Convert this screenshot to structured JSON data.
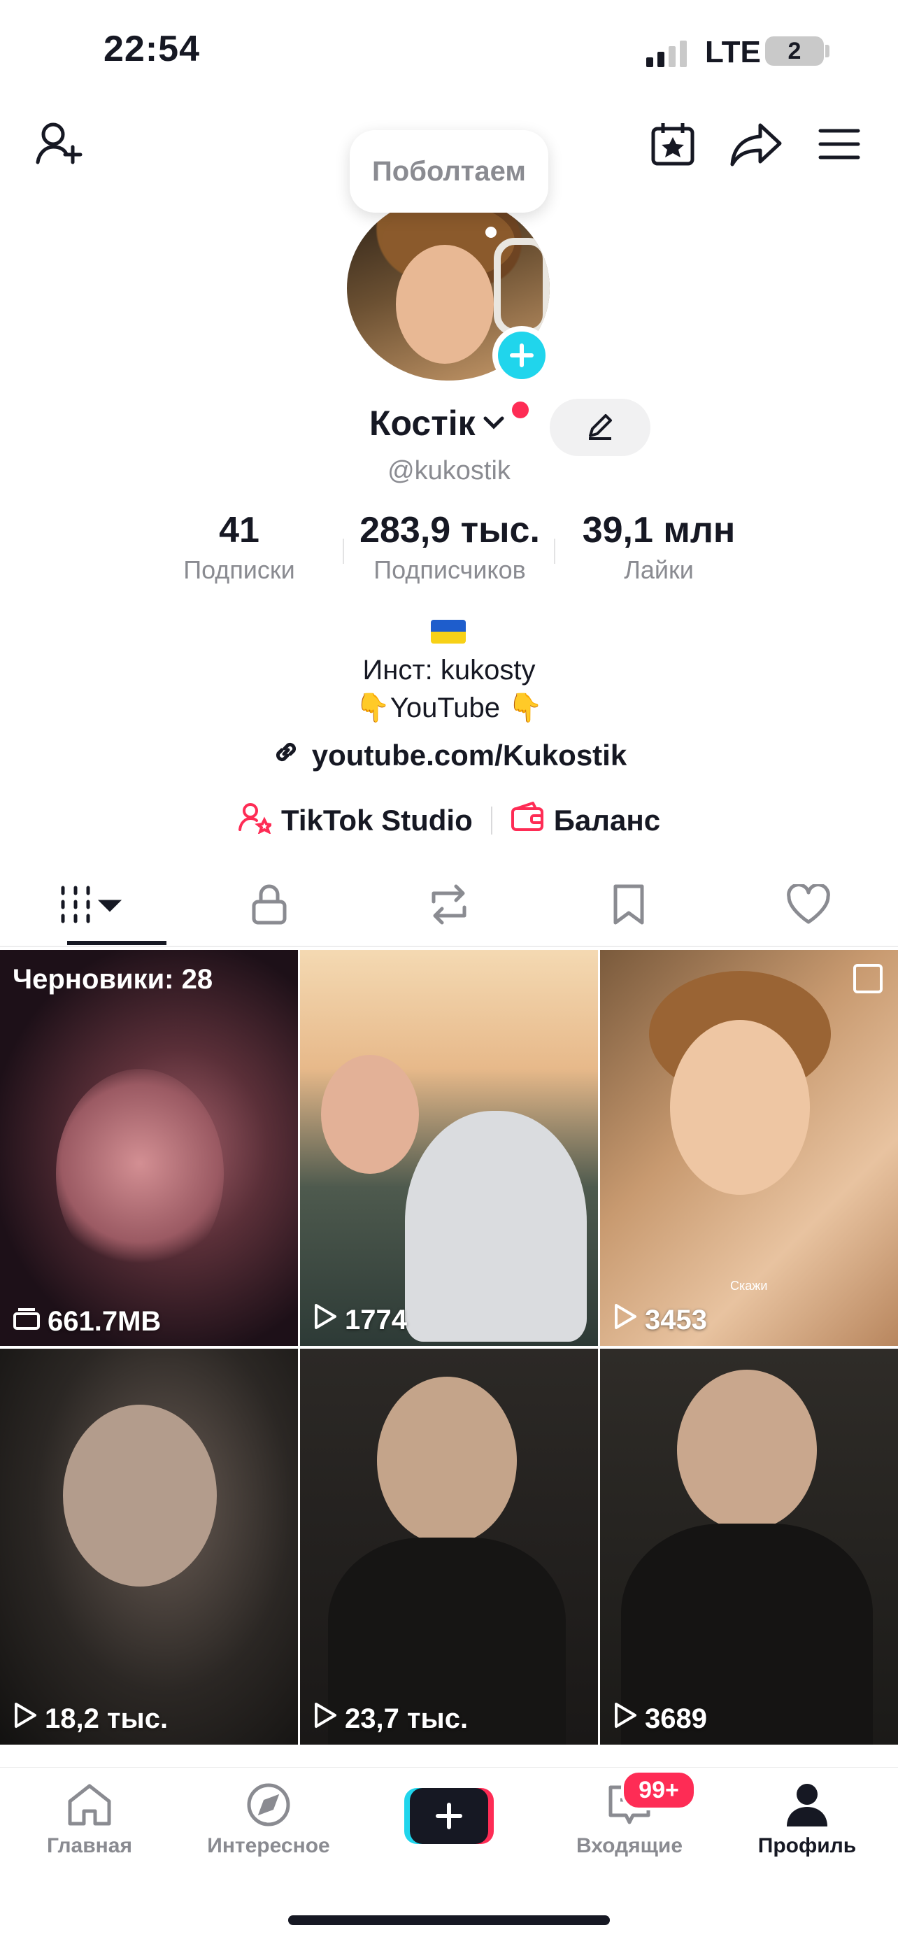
{
  "status_bar": {
    "time": "22:54",
    "network": "LTE",
    "battery": "2"
  },
  "header": {
    "add_friend_icon": "person-plus-icon",
    "calendar_icon": "calendar-star-icon",
    "share_icon": "share-arrow-icon",
    "menu_icon": "hamburger-menu-icon"
  },
  "profile": {
    "bubble_text": "Поболтаем",
    "name": "Костік",
    "handle": "@kukostik",
    "stats": [
      {
        "value": "41",
        "label": "Подписки"
      },
      {
        "value": "283,9 тыс.",
        "label": "Подписчиков"
      },
      {
        "value": "39,1 млн",
        "label": "Лайки"
      }
    ],
    "bio": {
      "line1": "Инст: kukosty",
      "line2": "👇YouTube 👇"
    },
    "link": "youtube.com/Kukostik",
    "shortcuts": [
      {
        "label": "TikTok Studio",
        "icon": "person-star-icon"
      },
      {
        "label": "Баланс",
        "icon": "wallet-icon"
      }
    ]
  },
  "tabs": [
    {
      "name": "videos",
      "icon": "grid-icon"
    },
    {
      "name": "private",
      "icon": "lock-icon"
    },
    {
      "name": "reposts",
      "icon": "repost-icon"
    },
    {
      "name": "favorites",
      "icon": "bookmark-icon"
    },
    {
      "name": "liked",
      "icon": "heart-icon"
    }
  ],
  "videos": [
    {
      "overlay": "661.7MB",
      "drafts_label": "Черновики: 28",
      "kind": "drafts"
    },
    {
      "overlay": "1774",
      "kind": "play"
    },
    {
      "overlay": "3453",
      "kind": "play",
      "caption": "Скажи"
    },
    {
      "overlay": "18,2 тыс.",
      "kind": "play"
    },
    {
      "overlay": "23,7 тыс.",
      "kind": "play"
    },
    {
      "overlay": "3689",
      "kind": "play"
    }
  ],
  "bottom_nav": {
    "home": "Главная",
    "explore": "Интересное",
    "inbox": "Входящие",
    "inbox_badge": "99+",
    "profile": "Профиль"
  },
  "colors": {
    "accent": "#fe2c55",
    "teal": "#20d5ec",
    "text": "#161823",
    "muted": "#8a8b91"
  }
}
